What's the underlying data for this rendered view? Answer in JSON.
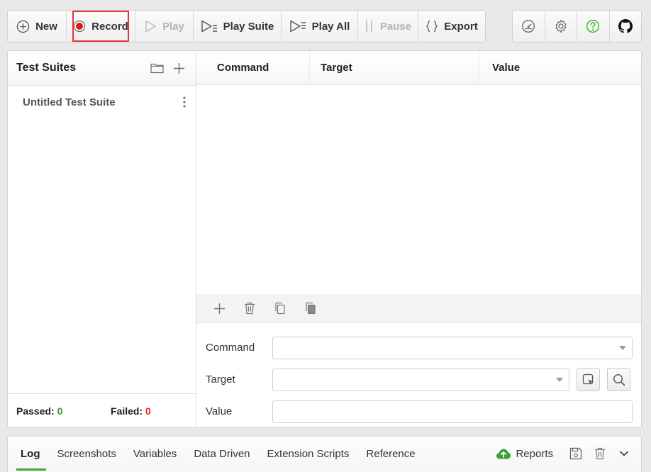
{
  "toolbar": {
    "new_label": "New",
    "record_label": "Record",
    "play_label": "Play",
    "play_suite_label": "Play Suite",
    "play_all_label": "Play All",
    "pause_label": "Pause",
    "export_label": "Export"
  },
  "sidebar": {
    "title": "Test Suites",
    "suites": [
      {
        "name": "Untitled Test Suite"
      }
    ],
    "passed_label": "Passed:",
    "passed_count": "0",
    "failed_label": "Failed:",
    "failed_count": "0"
  },
  "table": {
    "columns": [
      "Command",
      "Target",
      "Value"
    ]
  },
  "form": {
    "command_label": "Command",
    "command_value": "",
    "target_label": "Target",
    "target_value": "",
    "value_label": "Value",
    "value_value": ""
  },
  "bottom_tabs": {
    "tabs": [
      "Log",
      "Screenshots",
      "Variables",
      "Data Driven",
      "Extension Scripts",
      "Reference"
    ],
    "active_index": 0,
    "reports_label": "Reports"
  },
  "colors": {
    "record_dot": "#e01818",
    "record_highlight": "#e53434",
    "passed": "#2f9e3a",
    "failed": "#e02424",
    "help_icon": "#3dbb2e",
    "active_tab_underline": "#4aa33f",
    "reports_cloud": "#3f9e35"
  }
}
